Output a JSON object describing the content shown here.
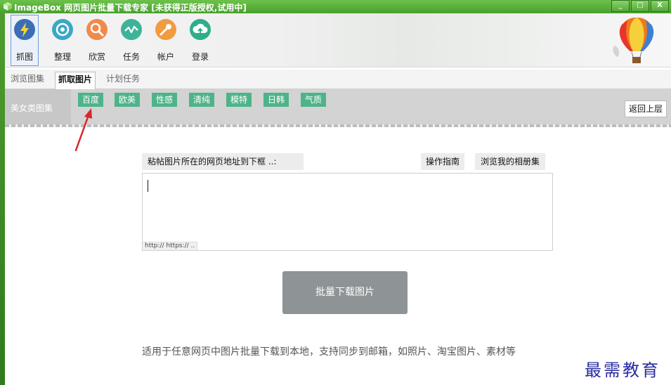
{
  "window": {
    "title": "ImageBox 网页图片批量下载专家 [未获得正版授权,试用中]",
    "controls": [
      "_",
      "□",
      "X"
    ]
  },
  "toolbar": {
    "items": [
      {
        "label": "抓图",
        "icon": "lightning-icon",
        "color": "#3b6fb5",
        "active": true
      },
      {
        "label": "整理",
        "icon": "eye-icon",
        "color": "#3aa8c4"
      },
      {
        "label": "欣赏",
        "icon": "search-icon",
        "color": "#f08a4b"
      },
      {
        "label": "任务",
        "icon": "pulse-icon",
        "color": "#3fb39a"
      },
      {
        "label": "帐户",
        "icon": "key-icon",
        "color": "#f29b3f"
      },
      {
        "label": "登录",
        "icon": "cloud-upload-icon",
        "color": "#2fae8c"
      }
    ]
  },
  "tabs": [
    {
      "label": "浏览图集",
      "active": false
    },
    {
      "label": "抓取图片",
      "active": true
    },
    {
      "label": "计划任务",
      "active": false
    }
  ],
  "category": {
    "title": "美女类图集",
    "chips": [
      "百度",
      "欧美",
      "性感",
      "清纯",
      "模特",
      "日韩",
      "气质"
    ],
    "back": "返回上层"
  },
  "form": {
    "paste_label": "粘帖图片所在的网页地址到下框 ..:",
    "guide": "操作指南",
    "album": "浏览我的相册集",
    "url_hint": "http:// https:// ..",
    "download": "批量下载图片",
    "description": "适用于任意网页中图片批量下载到本地，支持同步到邮箱，如照片、淘宝图片、素材等"
  },
  "watermark": "最需教育",
  "colors": {
    "title_green": "#56a83a",
    "chip_green": "#4fb38a",
    "download_button": "#8e9395",
    "arrow": "#d9262a"
  }
}
